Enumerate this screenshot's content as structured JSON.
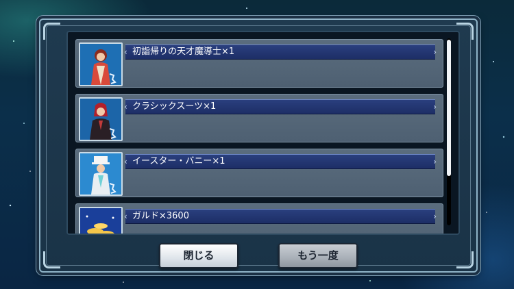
{
  "reward_list": {
    "items": [
      {
        "name": "初詣帰りの天才魔導士×1",
        "icon": "character-kimono-portrait"
      },
      {
        "name": "クラシックスーツ×1",
        "icon": "character-suit-portrait"
      },
      {
        "name": "イースター・バニー×1",
        "icon": "character-bunny-portrait"
      },
      {
        "name": "ガルド×3600",
        "icon": "gald-coins-icon"
      }
    ]
  },
  "buttons": {
    "close_label": "閉じる",
    "again_label": "もう一度"
  },
  "colors": {
    "name_bar": "#1d2e66",
    "item_bg": "#556779",
    "panel_bg": "#0a1622"
  }
}
